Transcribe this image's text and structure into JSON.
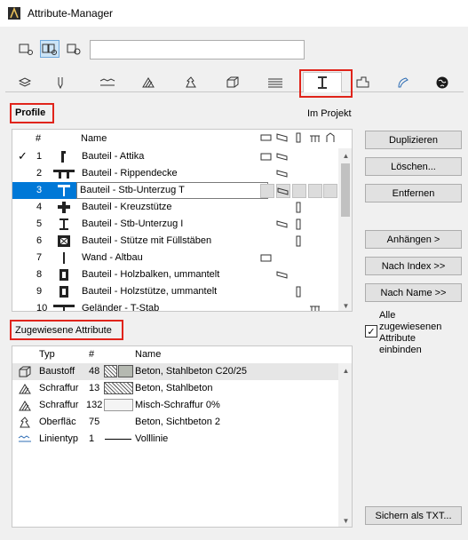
{
  "window": {
    "title": "Attribute-Manager"
  },
  "search": {
    "value": ""
  },
  "profile": {
    "heading": "Profile",
    "location": "Im Projekt"
  },
  "table": {
    "col_index": "#",
    "col_name": "Name",
    "rows": [
      {
        "check": "✓",
        "idx": "1",
        "name": "Bauteil - Attika"
      },
      {
        "check": "",
        "idx": "2",
        "name": "Bauteil - Rippendecke"
      },
      {
        "check": "",
        "idx": "3",
        "name": "Bauteil - Stb-Unterzug T"
      },
      {
        "check": "",
        "idx": "4",
        "name": "Bauteil - Kreuzstütze"
      },
      {
        "check": "",
        "idx": "5",
        "name": "Bauteil - Stb-Unterzug I"
      },
      {
        "check": "",
        "idx": "6",
        "name": "Bauteil - Stütze mit Füllstäben"
      },
      {
        "check": "",
        "idx": "7",
        "name": "Wand - Altbau"
      },
      {
        "check": "",
        "idx": "8",
        "name": "Bauteil - Holzbalken, ummantelt"
      },
      {
        "check": "",
        "idx": "9",
        "name": "Bauteil - Holzstütze, ummantelt"
      },
      {
        "check": "",
        "idx": "10",
        "name": "Geländer - T-Stab"
      }
    ]
  },
  "buttons": {
    "duplicate": "Duplizieren",
    "delete": "Löschen...",
    "remove": "Entfernen",
    "append": "Anhängen >",
    "by_index": "Nach Index >>",
    "by_name": "Nach Name >>",
    "save_txt": "Sichern als TXT..."
  },
  "include_all": {
    "label_lines": [
      "Alle",
      "zugewiesenen",
      "Attribute",
      "einbinden"
    ],
    "checked": true
  },
  "assigned": {
    "heading": "Zugewiesene Attribute",
    "col_type": "Typ",
    "col_index": "#",
    "col_name": "Name",
    "rows": [
      {
        "type": "Baustoff",
        "idx": "48",
        "name": "Beton, Stahlbeton C20/25",
        "icon": "building-material-icon"
      },
      {
        "type": "Schraffur",
        "idx": "13",
        "name": "Beton, Stahlbeton",
        "icon": "fill-icon"
      },
      {
        "type": "Schraffur",
        "idx": "132",
        "name": "Misch-Schraffur 0%",
        "icon": "fill-icon"
      },
      {
        "type": "Oberfläc",
        "idx": "75",
        "name": "Beton, Sichtbeton 2",
        "icon": "surface-icon"
      },
      {
        "type": "Linientyp",
        "idx": "1",
        "name": "Volllinie",
        "icon": "line-type-icon"
      }
    ]
  }
}
